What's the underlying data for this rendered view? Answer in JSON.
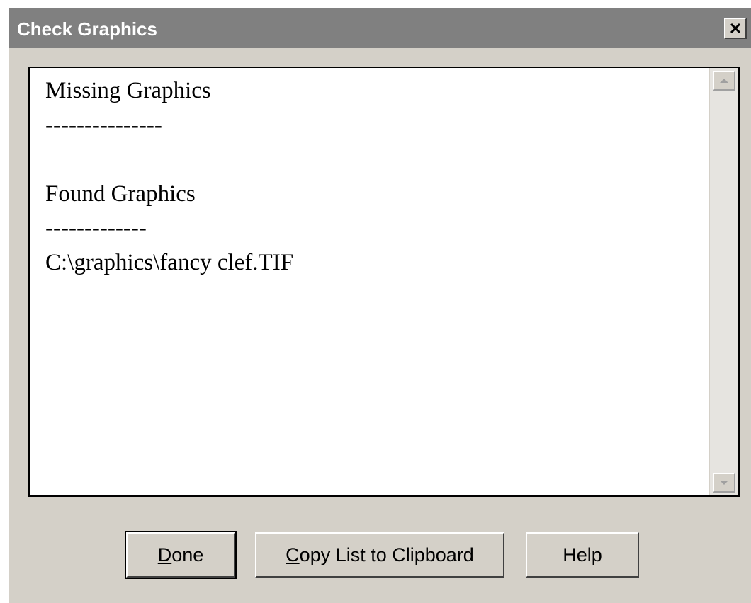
{
  "window": {
    "title": "Check Graphics",
    "close_label": "×"
  },
  "list": {
    "lines": [
      "Missing Graphics",
      "---------------",
      "",
      "Found Graphics",
      "-------------",
      "C:\\graphics\\fancy clef.TIF"
    ]
  },
  "buttons": {
    "done": {
      "mnemonic": "D",
      "rest": "one"
    },
    "copy": {
      "mnemonic": "C",
      "rest": "opy List to Clipboard"
    },
    "help": {
      "label": "Help"
    }
  },
  "icons": {
    "close": "close-icon",
    "scroll_up": "scroll-up-arrow-icon",
    "scroll_down": "scroll-down-arrow-icon"
  },
  "colors": {
    "titlebar": "#808080",
    "dialog_bg": "#d4d0c8",
    "listbox_bg": "#ffffff"
  }
}
